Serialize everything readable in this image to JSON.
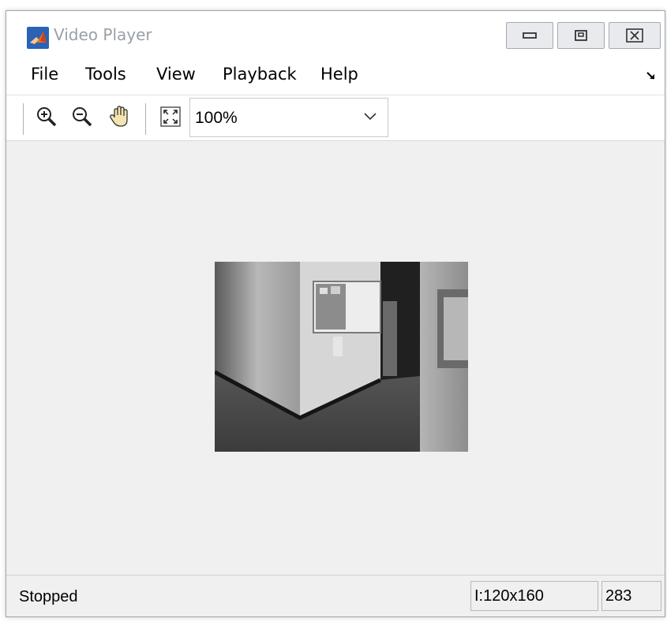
{
  "window": {
    "title": "Video Player",
    "controls": [
      "minimize",
      "maximize",
      "close"
    ]
  },
  "menu": {
    "items": [
      "File",
      "Tools",
      "View",
      "Playback",
      "Help"
    ]
  },
  "toolbar": {
    "buttons": [
      "zoom-in-icon",
      "zoom-out-icon",
      "pan-hand-icon",
      "fit-to-window-icon"
    ],
    "zoom_value": "100%"
  },
  "status": {
    "state": "Stopped",
    "dimensions": "I:120x160",
    "frame": "283"
  },
  "colors": {
    "window_bg": "#f0f0f0",
    "bar_bg": "#ffffff",
    "title_text": "#9aa0a6"
  }
}
